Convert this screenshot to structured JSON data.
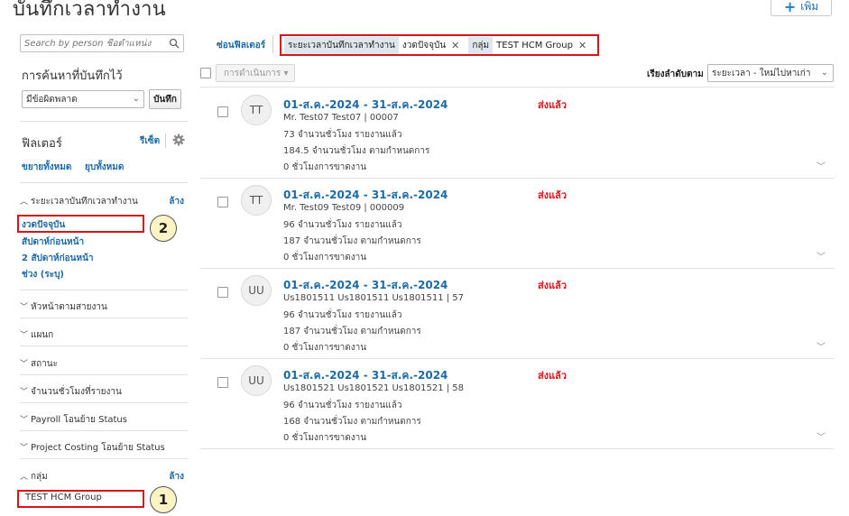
{
  "header": {
    "title": "บันทึกเวลาทำงาน",
    "add_label": "เพิ่ม"
  },
  "sidebar": {
    "search_placeholder": "Search by person ชื่อตำแหน่ง",
    "saved_search_title": "การค้นหาที่บันทึกไว้",
    "saved_search_value": "มีข้อผิดพลาด",
    "save_label": "บันทึก",
    "filters_title": "ฟิลเตอร์",
    "reset_label": "รีเซ็ต",
    "expand_all": "ขยายทั้งหมด",
    "collapse_all": "ยุบทั้งหมด",
    "period_section": {
      "label": "ระยะเวลาบันทึกเวลาทำงาน",
      "clear": "ล้าง",
      "options": [
        "งวดปัจจุบัน",
        "สัปดาห์ก่อนหน้า",
        "2 สัปดาห์ก่อนหน้า",
        "ช่วง (ระบุ)"
      ]
    },
    "sections": [
      "หัวหน้าตามสายงาน",
      "แผนก",
      "สถานะ",
      "จำนวนชั่วโมงที่รายงาน",
      "Payroll โอนย้าย Status",
      "Project Costing โอนย้าย Status"
    ],
    "group_section": {
      "label": "กลุ่ม",
      "clear": "ล้าง",
      "item": "TEST HCM Group"
    },
    "callouts": [
      "1",
      "2"
    ]
  },
  "main": {
    "hide_filters": "ซ่อนฟิลเตอร์",
    "chips": [
      {
        "label": "ระยะเวลาบันทึกเวลาทำงาน",
        "value": "งวดปัจจุบัน"
      },
      {
        "label": "กลุ่ม",
        "value": "TEST HCM Group"
      }
    ],
    "actions_label": "การดำเนินการ",
    "sort_label": "เรียงลำดับตาม",
    "sort_value": "ระยะเวลา - ใหม่ไปหาเก่า",
    "rows": [
      {
        "initials": "TT",
        "period": "01-ส.ค.-2024  -  31-ส.ค.-2024",
        "person": "Mr. Test07 Test07 | 00007",
        "reported": "73 จำนวนชั่วโมง รายงานแล้ว",
        "scheduled": "184.5 จำนวนชั่วโมง ตามกำหนดการ",
        "absence": "0 ชั่วโมงการขาดงาน",
        "status": "ส่งแล้ว"
      },
      {
        "initials": "TT",
        "period": "01-ส.ค.-2024  -  31-ส.ค.-2024",
        "person": "Mr. Test09 Test09 | 000009",
        "reported": "96 จำนวนชั่วโมง รายงานแล้ว",
        "scheduled": "187 จำนวนชั่วโมง ตามกำหนดการ",
        "absence": "0 ชั่วโมงการขาดงาน",
        "status": "ส่งแล้ว"
      },
      {
        "initials": "UU",
        "period": "01-ส.ค.-2024  -  31-ส.ค.-2024",
        "person": "Us1801511 Us1801511 Us1801511 | 57",
        "reported": "96 จำนวนชั่วโมง รายงานแล้ว",
        "scheduled": "187 จำนวนชั่วโมง ตามกำหนดการ",
        "absence": "0 ชั่วโมงการขาดงาน",
        "status": "ส่งแล้ว"
      },
      {
        "initials": "UU",
        "period": "01-ส.ค.-2024  -  31-ส.ค.-2024",
        "person": "Us1801521 Us1801521 Us1801521 | 58",
        "reported": "96 จำนวนชั่วโมง รายงานแล้ว",
        "scheduled": "168 จำนวนชั่วโมง ตามกำหนดการ",
        "absence": "0 ชั่วโมงการขาดงาน",
        "status": "ส่งแล้ว"
      }
    ]
  }
}
